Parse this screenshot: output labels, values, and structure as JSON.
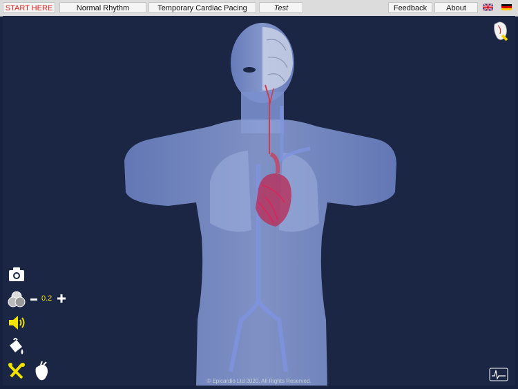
{
  "toolbar": {
    "start_here": "START HERE",
    "normal_rhythm": "Normal Rhythm",
    "temporary_pacing": "Temporary Cardiac Pacing",
    "test": "Test",
    "feedback": "Feedback",
    "about": "About"
  },
  "languages": [
    "en-flag-icon",
    "de-flag-icon"
  ],
  "opacity": {
    "value": "0.2"
  },
  "footer": {
    "copyright": "© Epicardio Ltd 2020. All Rights Reserved."
  },
  "icons": [
    "camera-icon",
    "layers-icon",
    "minus-icon",
    "plus-icon",
    "speaker-icon",
    "paint-bucket-icon",
    "tools-icon",
    "heart-icon",
    "heart-view-icon",
    "epicardio-logo-icon"
  ],
  "colors": {
    "background": "#1a2644",
    "accent_red": "#e0201a",
    "accent_yellow": "#f2e200"
  }
}
